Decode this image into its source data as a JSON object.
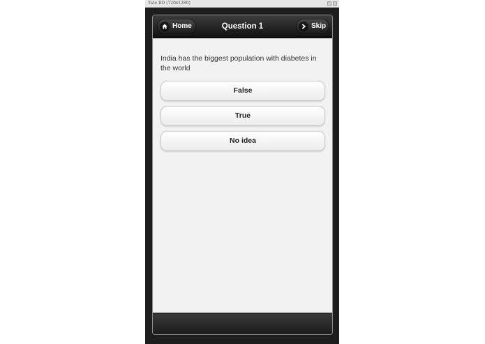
{
  "window": {
    "title": "Tate BD (720x1280)"
  },
  "header": {
    "home_label": "Home",
    "home_icon": "home-icon",
    "title": "Question 1",
    "skip_label": "Skip",
    "skip_icon": "chevron-right-icon"
  },
  "question": {
    "text": "India has the biggest population with diabetes in the world"
  },
  "answers": [
    {
      "label": "False"
    },
    {
      "label": "True"
    },
    {
      "label": "No idea"
    }
  ],
  "colors": {
    "header_bg": "#1a1a1a",
    "content_bg": "#f2f2f2",
    "button_bg": "#ffffff",
    "text": "#222222"
  }
}
